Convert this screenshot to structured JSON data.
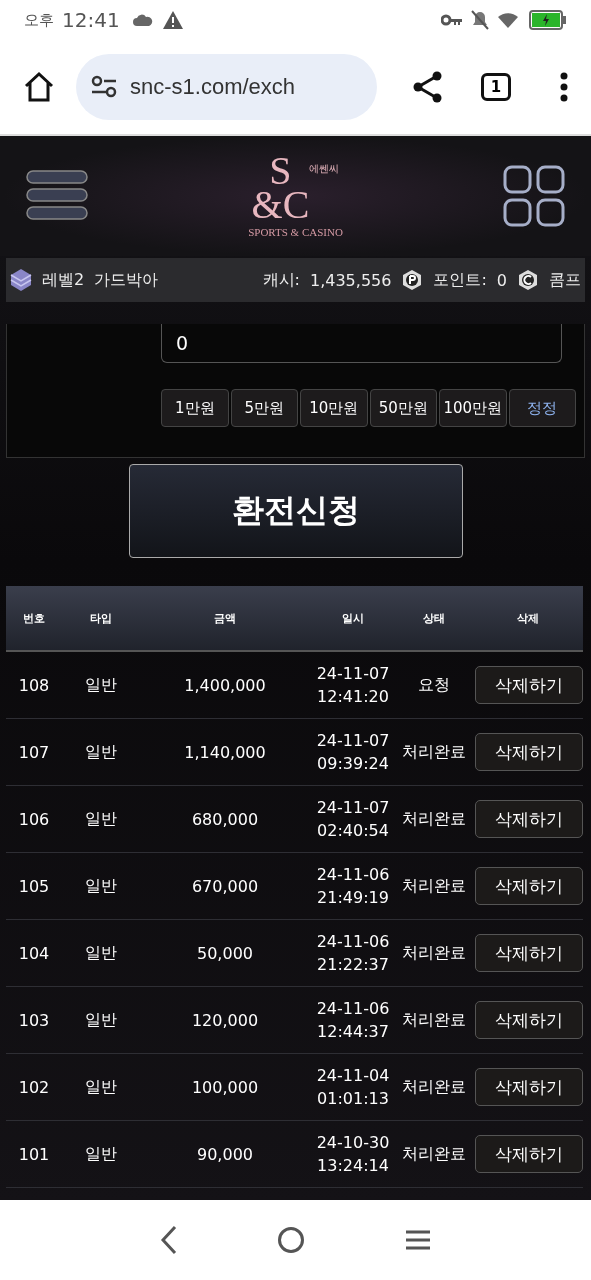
{
  "status_bar": {
    "ampm": "오후",
    "time": "12:41"
  },
  "browser": {
    "url": "snc-s1.com/exch",
    "tab_count": "1"
  },
  "logo": {
    "korean": "에쎈씨",
    "mark_top": "S",
    "mark_bottom": "&C",
    "tagline": "SPORTS & CASINO"
  },
  "user_bar": {
    "level": "레벨2",
    "nickname": "가드박아",
    "cash_label": "캐시:",
    "cash": "1,435,556",
    "point_label": "포인트:",
    "point": "0",
    "comp_label": "콤프"
  },
  "amount_field": {
    "value": "0"
  },
  "amount_buttons": [
    {
      "label": "1만원",
      "kind": "add"
    },
    {
      "label": "5만원",
      "kind": "add"
    },
    {
      "label": "10만원",
      "kind": "add"
    },
    {
      "label": "50만원",
      "kind": "add"
    },
    {
      "label": "100만원",
      "kind": "add"
    },
    {
      "label": "정정",
      "kind": "reset"
    }
  ],
  "submit_button": "환전신청",
  "table": {
    "columns": [
      "번호",
      "타입",
      "금액",
      "일시",
      "상태",
      "삭제"
    ],
    "rows": [
      {
        "no": "108",
        "type": "일반",
        "amount": "1,400,000",
        "date": "24-11-07",
        "time": "12:41:20",
        "status": "요청",
        "action": "삭제하기"
      },
      {
        "no": "107",
        "type": "일반",
        "amount": "1,140,000",
        "date": "24-11-07",
        "time": "09:39:24",
        "status": "처리완료",
        "action": "삭제하기"
      },
      {
        "no": "106",
        "type": "일반",
        "amount": "680,000",
        "date": "24-11-07",
        "time": "02:40:54",
        "status": "처리완료",
        "action": "삭제하기"
      },
      {
        "no": "105",
        "type": "일반",
        "amount": "670,000",
        "date": "24-11-06",
        "time": "21:49:19",
        "status": "처리완료",
        "action": "삭제하기"
      },
      {
        "no": "104",
        "type": "일반",
        "amount": "50,000",
        "date": "24-11-06",
        "time": "21:22:37",
        "status": "처리완료",
        "action": "삭제하기"
      },
      {
        "no": "103",
        "type": "일반",
        "amount": "120,000",
        "date": "24-11-06",
        "time": "12:44:37",
        "status": "처리완료",
        "action": "삭제하기"
      },
      {
        "no": "102",
        "type": "일반",
        "amount": "100,000",
        "date": "24-11-04",
        "time": "01:01:13",
        "status": "처리완료",
        "action": "삭제하기"
      },
      {
        "no": "101",
        "type": "일반",
        "amount": "90,000",
        "date": "24-10-30",
        "time": "13:24:14",
        "status": "처리완료",
        "action": "삭제하기"
      }
    ]
  }
}
